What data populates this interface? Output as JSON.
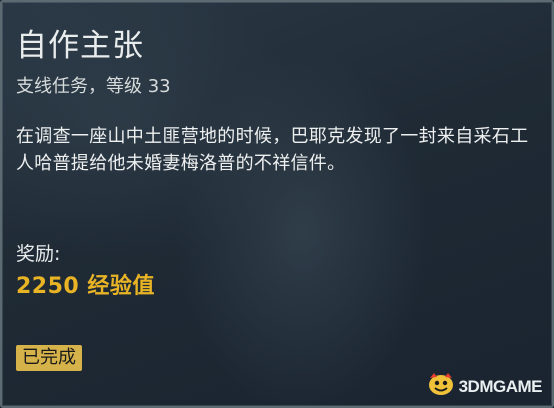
{
  "quest": {
    "title": "自作主张",
    "subtitle": "支线任务，等级 33",
    "description": "在调查一座山中土匪营地的时候，巴耶克发现了一封来自采石工人哈普提给他未婚妻梅洛普的不祥信件。",
    "reward_label": "奖励:",
    "reward_value": "2250 经验值",
    "status": "已完成"
  },
  "watermark": {
    "text": "3DMGAME",
    "icon": "3dm-logo-icon"
  },
  "colors": {
    "background": "#1f2a35",
    "border": "#5c6a72",
    "reward": "#e8b325",
    "badge": "#d6b24a"
  }
}
